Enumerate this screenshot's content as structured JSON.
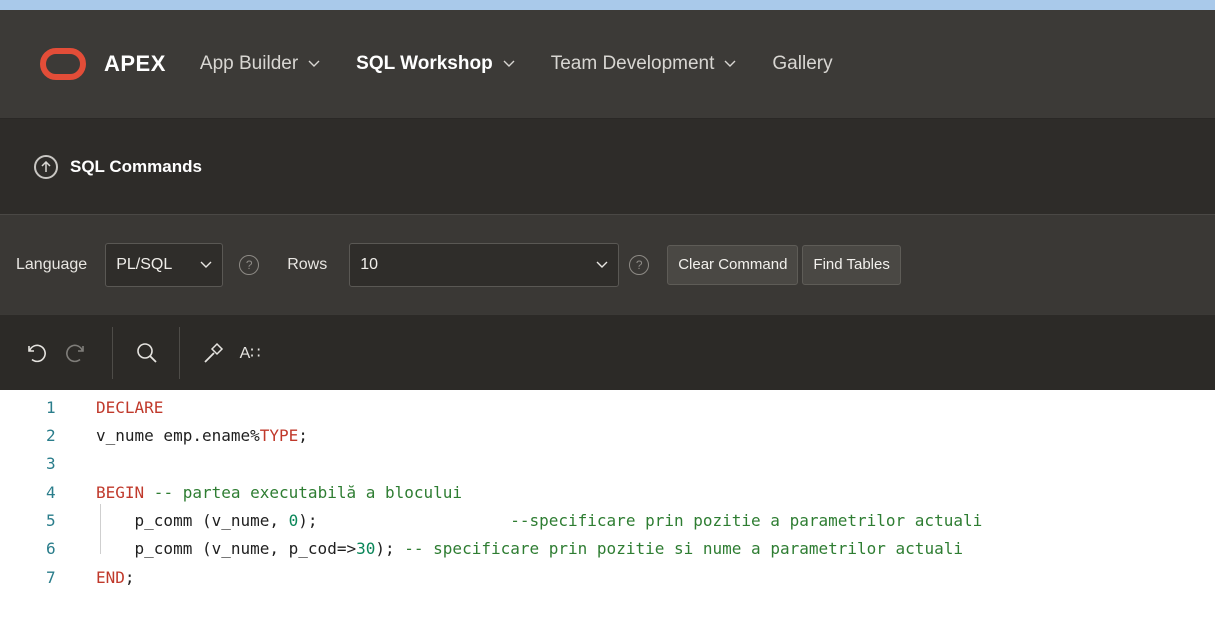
{
  "nav": {
    "brand": "APEX",
    "items": [
      {
        "label": "App Builder",
        "has_menu": true
      },
      {
        "label": "SQL Workshop",
        "has_menu": true,
        "active": true
      },
      {
        "label": "Team Development",
        "has_menu": true
      },
      {
        "label": "Gallery",
        "has_menu": false
      }
    ]
  },
  "page": {
    "title": "SQL Commands"
  },
  "toolbar": {
    "language_label": "Language",
    "language_value": "PL/SQL",
    "rows_label": "Rows",
    "rows_value": "10",
    "clear_command": "Clear Command",
    "find_tables": "Find Tables"
  },
  "editor_toolbar": {
    "icons": [
      "undo-icon",
      "redo-icon",
      "search-icon",
      "hammer-icon",
      "format-text-icon"
    ],
    "format_label": "A∷"
  },
  "code": {
    "lines": [
      {
        "n": "1",
        "tokens": [
          {
            "t": "DECLARE",
            "c": "kw"
          }
        ]
      },
      {
        "n": "2",
        "tokens": [
          {
            "t": "v_nume emp.ename%",
            "c": ""
          },
          {
            "t": "TYPE",
            "c": "kw"
          },
          {
            "t": ";",
            "c": ""
          }
        ]
      },
      {
        "n": "3",
        "tokens": []
      },
      {
        "n": "4",
        "tokens": [
          {
            "t": "BEGIN",
            "c": "kw"
          },
          {
            "t": " -- partea executabilă a blocului",
            "c": "cm"
          }
        ]
      },
      {
        "n": "5",
        "tokens": [
          {
            "t": "    p_comm (v_nume, ",
            "c": ""
          },
          {
            "t": "0",
            "c": "num"
          },
          {
            "t": ");                    ",
            "c": ""
          },
          {
            "t": "--specificare prin pozitie a parametrilor actuali",
            "c": "cm"
          }
        ]
      },
      {
        "n": "6",
        "tokens": [
          {
            "t": "    p_comm (v_nume, p_cod=>",
            "c": ""
          },
          {
            "t": "30",
            "c": "num"
          },
          {
            "t": "); ",
            "c": ""
          },
          {
            "t": "-- specificare prin pozitie si nume a parametrilor actuali",
            "c": "cm"
          }
        ]
      },
      {
        "n": "7",
        "tokens": [
          {
            "t": "END",
            "c": "kw"
          },
          {
            "t": ";",
            "c": ""
          }
        ]
      }
    ]
  },
  "colors": {
    "accent": "#e34d38",
    "keyword": "#c0392b",
    "comment": "#2e7d32",
    "number": "#098658",
    "line_number": "#2a7d8b"
  }
}
